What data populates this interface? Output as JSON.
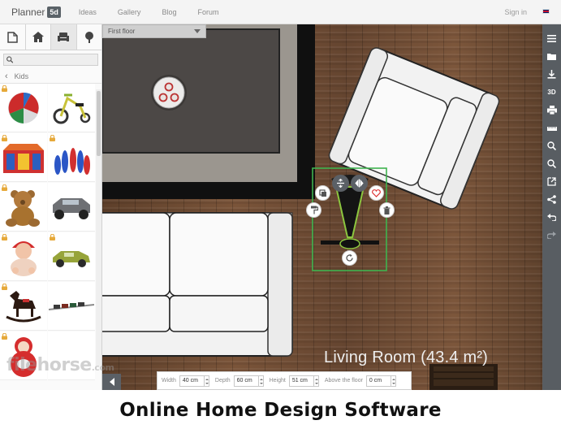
{
  "header": {
    "logo_text": "Planner",
    "logo_badge": "5d",
    "nav": [
      "Ideas",
      "Gallery",
      "Blog",
      "Forum"
    ],
    "signin": "Sign in"
  },
  "sidebar": {
    "tools": [
      "construction-icon",
      "rooms-icon",
      "furniture-icon",
      "outdoor-icon"
    ],
    "search_placeholder": "",
    "category": "Kids",
    "items": [
      {
        "name": "beach-ball",
        "locked": true
      },
      {
        "name": "tricycle",
        "locked": false
      },
      {
        "name": "play-house",
        "locked": true
      },
      {
        "name": "bowling-pins",
        "locked": true
      },
      {
        "name": "teddy-bear",
        "locked": true
      },
      {
        "name": "toy-truck",
        "locked": false
      },
      {
        "name": "baby-doll",
        "locked": true
      },
      {
        "name": "toy-car",
        "locked": true
      },
      {
        "name": "rocking-horse",
        "locked": true
      },
      {
        "name": "toy-train",
        "locked": false
      },
      {
        "name": "roly-poly-doll",
        "locked": true
      }
    ]
  },
  "canvas": {
    "floor": "First floor",
    "room_label": "Living Room (43.4 m²)"
  },
  "dimensions": {
    "width_label": "Width",
    "width_value": "40 cm",
    "depth_label": "Depth",
    "depth_value": "60 cm",
    "height_label": "Height",
    "height_value": "51 cm",
    "above_label": "Above the floor",
    "above_value": "0 cm"
  },
  "right_toolbar": [
    "menu-icon",
    "folder-icon",
    "download-icon",
    "3D",
    "print-icon",
    "ruler-icon",
    "zoom-in-icon",
    "zoom-out-icon",
    "fullscreen-icon",
    "share-icon",
    "undo-icon",
    "redo-icon"
  ],
  "watermark": {
    "main": "filehorse",
    "suffix": ".com"
  },
  "caption": "Online Home Design Software",
  "colors": {
    "selection": "#3fb34f",
    "toolbar": "#585d62",
    "wood": "#6a4a33"
  }
}
